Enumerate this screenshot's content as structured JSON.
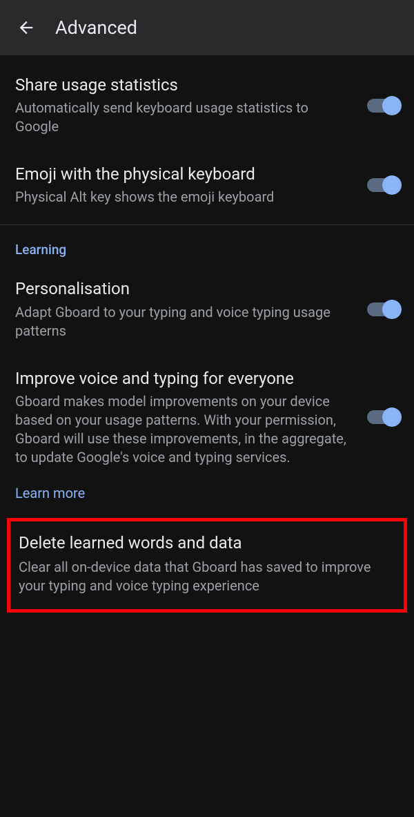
{
  "header": {
    "title": "Advanced"
  },
  "settings": {
    "share_usage": {
      "title": "Share usage statistics",
      "subtitle": "Automatically send keyboard usage statistics to Google"
    },
    "emoji_physical": {
      "title": "Emoji with the physical keyboard",
      "subtitle": "Physical Alt key shows the emoji keyboard"
    }
  },
  "learning": {
    "section_label": "Learning",
    "personalisation": {
      "title": "Personalisation",
      "subtitle": "Adapt Gboard to your typing and voice typing usage patterns"
    },
    "improve_voice": {
      "title": "Improve voice and typing for everyone",
      "subtitle": "Gboard makes model improvements on your device based on your usage patterns. With your permission, Gboard will use these improvements, in the aggregate, to update Google's voice and typing services."
    },
    "learn_more": "Learn more",
    "delete_learned": {
      "title": "Delete learned words and data",
      "subtitle": "Clear all on-device data that Gboard has saved to improve your typing and voice typing experience"
    }
  }
}
